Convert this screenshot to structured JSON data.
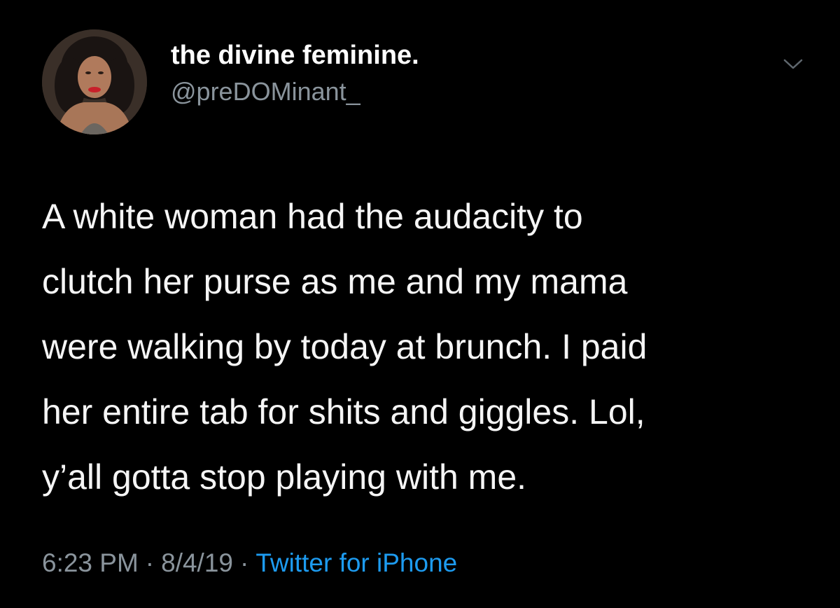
{
  "author": {
    "display_name": "the divine feminine.",
    "handle": "@preDOMinant_",
    "avatar_icon": "profile-photo"
  },
  "tweet": {
    "lines": [
      "A white woman had the audacity to",
      "clutch her purse as me and my mama",
      "were walking by today at brunch. I paid",
      "her entire tab for shits and giggles. Lol,",
      "y’all gotta stop playing with me."
    ]
  },
  "meta": {
    "time": "6:23 PM",
    "separator": "·",
    "date": "8/4/19",
    "source": "Twitter for iPhone"
  },
  "menu": {
    "icon": "chevron-down-icon"
  },
  "colors": {
    "background": "#000000",
    "text": "#ffffff",
    "secondary": "#8a949c",
    "link": "#1d9bf0"
  }
}
